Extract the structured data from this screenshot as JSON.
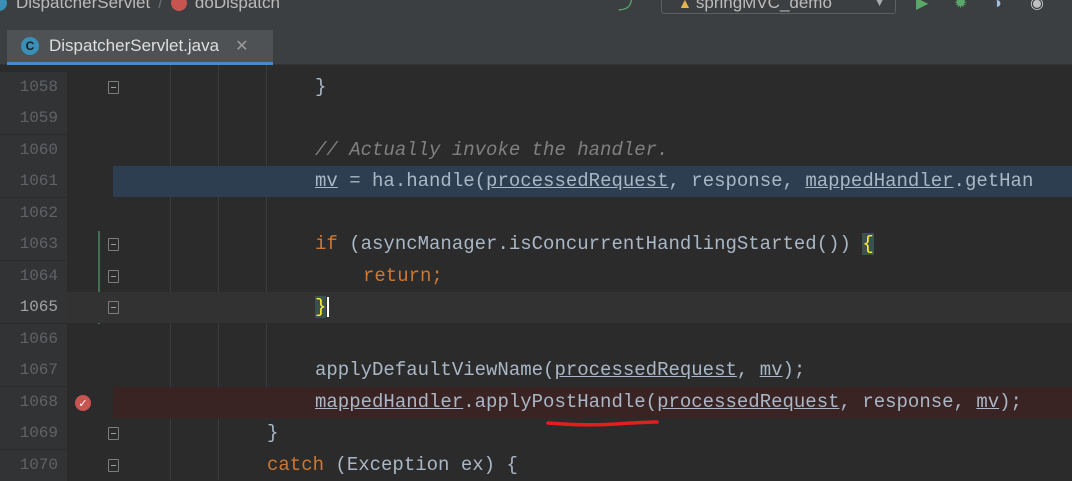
{
  "breadcrumbs": [
    {
      "icon": "class-icon",
      "label": "DispatcherServlet"
    },
    {
      "icon": "method-icon",
      "label": "doDispatch"
    }
  ],
  "toolbar": {
    "run_config": "springMVC_demo"
  },
  "tab": {
    "label": "DispatcherServlet.java",
    "icon_letter": "C"
  },
  "colors": {
    "current_line_debug": "#2d3e50",
    "breakpoint_line": "#3a2323",
    "breakpoint": "#c75450",
    "annotation_underline": "#e51d1d"
  },
  "lines": [
    {
      "num": "1058",
      "code": "}"
    },
    {
      "num": "1059",
      "code": ""
    },
    {
      "num": "1060",
      "code": "// Actually invoke the handler."
    },
    {
      "num": "1061",
      "code": "mv = ha.handle(processedRequest, response, mappedHandler.getHan"
    },
    {
      "num": "1062",
      "code": ""
    },
    {
      "num": "1063",
      "code": "if (asyncManager.isConcurrentHandlingStarted()) {"
    },
    {
      "num": "1064",
      "code": "return;"
    },
    {
      "num": "1065",
      "code": "}"
    },
    {
      "num": "1066",
      "code": ""
    },
    {
      "num": "1067",
      "code": "applyDefaultViewName(processedRequest, mv);"
    },
    {
      "num": "1068",
      "code": "mappedHandler.applyPostHandle(processedRequest, response, mv);"
    },
    {
      "num": "1069",
      "code": "}"
    },
    {
      "num": "1070",
      "code": "catch (Exception ex) {"
    }
  ]
}
